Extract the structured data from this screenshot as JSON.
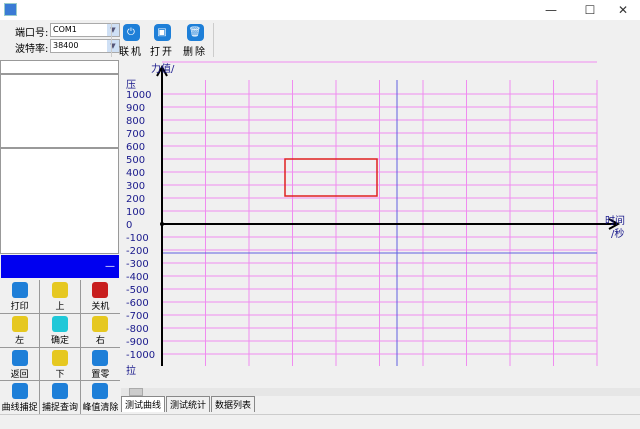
{
  "window": {
    "minimize": "—",
    "maximize": "☐",
    "close": "✕"
  },
  "toolbar": {
    "port_label": "端口号:",
    "port_value": "COM1",
    "baud_label": "波特率:",
    "baud_value": "38400",
    "buttons": [
      {
        "label": "联机",
        "icon": "power-icon"
      },
      {
        "label": "打开",
        "icon": "open-icon"
      },
      {
        "label": "删除",
        "icon": "trash-icon"
      }
    ]
  },
  "left": {
    "display_value": "—",
    "keys": [
      {
        "label": "打印",
        "icon": "print-icon",
        "color": "#1e7fd8"
      },
      {
        "label": "上",
        "icon": "arrow-up-icon",
        "color": "#e6c820"
      },
      {
        "label": "关机",
        "icon": "power-off-icon",
        "color": "#c81e1e"
      },
      {
        "label": "左",
        "icon": "arrow-left-icon",
        "color": "#e6c820"
      },
      {
        "label": "确定",
        "icon": "ok-icon",
        "color": "#20c8d8"
      },
      {
        "label": "右",
        "icon": "arrow-right-icon",
        "color": "#e6c820"
      },
      {
        "label": "返回",
        "icon": "return-icon",
        "color": "#1e7fd8"
      },
      {
        "label": "下",
        "icon": "arrow-down-icon",
        "color": "#e6c820"
      },
      {
        "label": "置零",
        "icon": "zero-icon",
        "color": "#1e7fd8"
      },
      {
        "label": "曲线捕捉",
        "icon": "curve-icon",
        "color": "#1e7fd8"
      },
      {
        "label": "捕捉查询",
        "icon": "search-icon",
        "color": "#1e7fd8"
      },
      {
        "label": "峰值清除",
        "icon": "clear-icon",
        "color": "#1e7fd8"
      }
    ]
  },
  "chart": {
    "y_title": "力值/",
    "y_top": "压",
    "y_bottom": "拉",
    "x_title": "时间",
    "x_unit": "/秒",
    "y_ticks": [
      "1000",
      "900",
      "800",
      "700",
      "600",
      "500",
      "400",
      "300",
      "200",
      "100",
      "0",
      "-100",
      "-200",
      "-300",
      "-400",
      "-500",
      "-600",
      "-700",
      "-800",
      "-900",
      "-1000"
    ],
    "grid_color": "#f08cf0",
    "cursor_color": "#6060e0",
    "selection_color": "#e02020"
  },
  "tabs": [
    "测试曲线",
    "测试统计",
    "数据列表"
  ]
}
